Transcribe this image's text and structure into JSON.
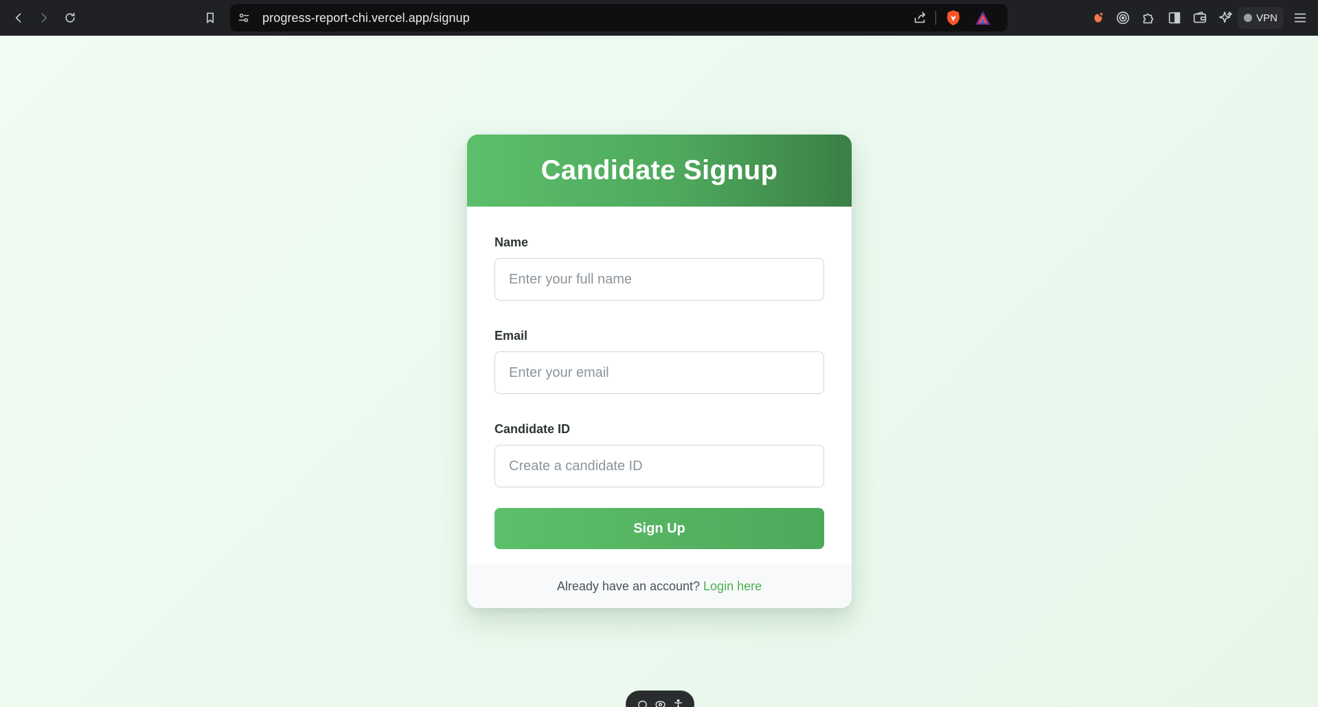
{
  "browser": {
    "url": "progress-report-chi.vercel.app/signup",
    "vpn_label": "VPN"
  },
  "signup": {
    "title": "Candidate Signup",
    "fields": [
      {
        "label": "Name",
        "placeholder": "Enter your full name"
      },
      {
        "label": "Email",
        "placeholder": "Enter your email"
      },
      {
        "label": "Candidate ID",
        "placeholder": "Create a candidate ID"
      }
    ],
    "submit_label": "Sign Up",
    "footer_text": "Already have an account?",
    "footer_link": "Login here"
  },
  "colors": {
    "accent": "#4caf50",
    "header_gradient": [
      "#5cbf6a",
      "#3b7f45"
    ],
    "page_bg": "#eaf8ee"
  },
  "icons": {
    "browser": [
      "back-icon",
      "forward-icon",
      "reload-icon",
      "bookmark-icon",
      "site-info-icon",
      "share-icon",
      "brave-shield-icon",
      "brave-rewards-icon",
      "leo-icon",
      "ad-block-icon",
      "extensions-icon",
      "sidebar-icon",
      "wallet-icon",
      "ai-chat-icon",
      "menu-icon"
    ],
    "floating": [
      "comment-icon",
      "eye-icon",
      "accessibility-icon"
    ]
  }
}
